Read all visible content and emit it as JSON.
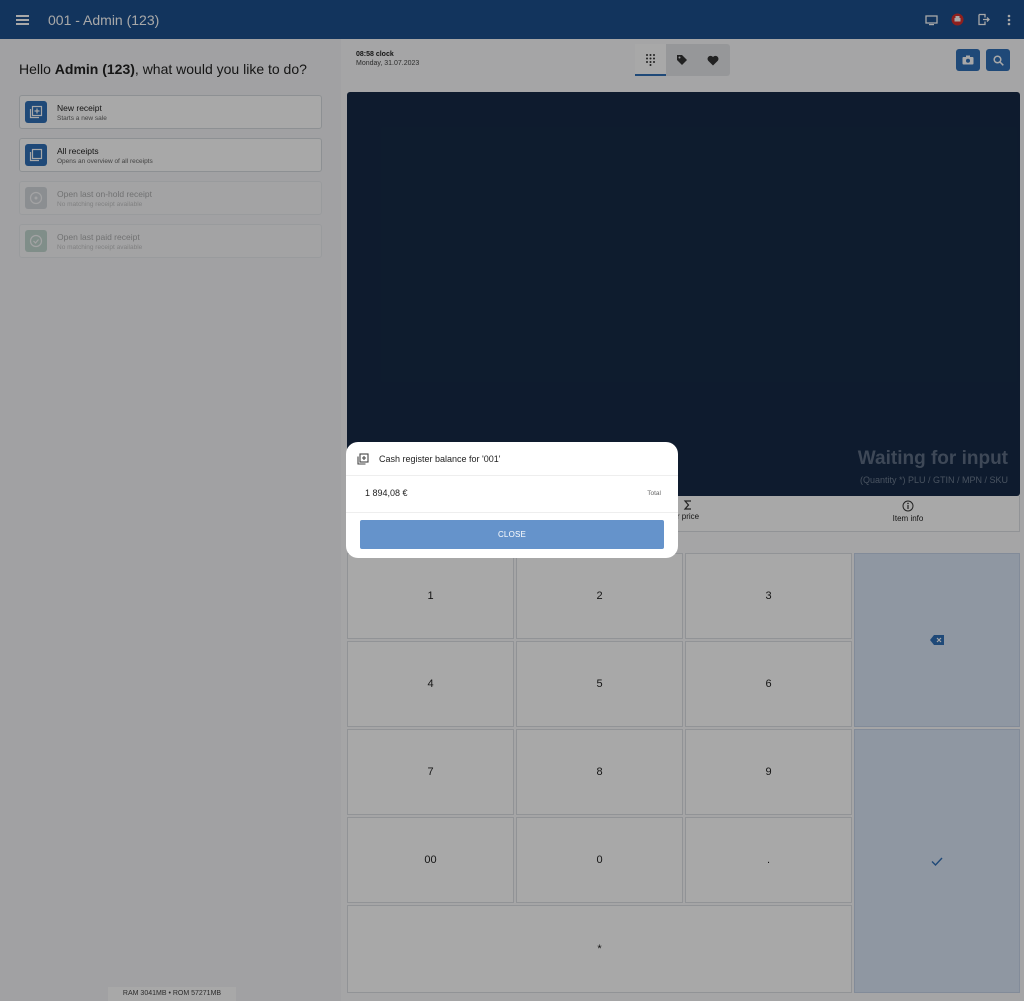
{
  "header": {
    "title": "001 - Admin (123)",
    "icons": [
      "menu-icon",
      "monitor-icon",
      "printer-icon",
      "logout-icon",
      "more-vert-icon"
    ]
  },
  "left": {
    "greeting": {
      "prefix": "Hello ",
      "user": "Admin (123)",
      "suffix": ", what would you like to do?"
    },
    "actions": [
      {
        "label": "New receipt",
        "sub": "Starts a new sale",
        "enabled": true
      },
      {
        "label": "All receipts",
        "sub": "Opens an overview of all receipts",
        "enabled": true
      },
      {
        "label": "Open last on-hold receipt",
        "sub": "No matching receipt available",
        "enabled": false
      },
      {
        "label": "Open last paid receipt",
        "sub": "No matching receipt available",
        "enabled": false
      }
    ],
    "sysinfo": "RAM 3041MB • ROM 57271MB"
  },
  "right": {
    "clock": {
      "time": "08:58 clock",
      "date": "Monday, 31.07.2023"
    },
    "tabs": [
      "keypad-icon",
      "tag-icon",
      "heart-icon"
    ],
    "display": {
      "waiting": "Waiting for input",
      "hint": "(Quantity *) PLU / GTIN / MPN / SKU"
    },
    "functions": {
      "price_partial": "r price",
      "item_info": "Item info"
    },
    "keys": [
      "1",
      "2",
      "3",
      "4",
      "5",
      "6",
      "7",
      "8",
      "9",
      "00",
      "0",
      ".",
      "*"
    ]
  },
  "dialog": {
    "title": "Cash register balance for '001'",
    "amount": "1 894,08 €",
    "amount_label": "Total",
    "close_label": "CLOSE"
  },
  "colors": {
    "header": "#1c4f8d",
    "accent": "#2f6fb6",
    "display_bg": "#162a46",
    "button": "#6593cb"
  }
}
